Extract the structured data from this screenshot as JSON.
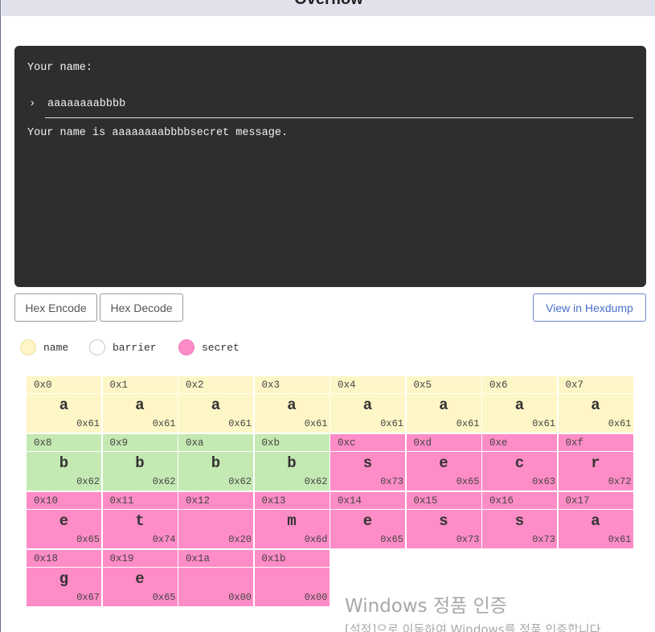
{
  "header": {
    "title": "Overflow"
  },
  "terminal": {
    "prompt": "Your name:",
    "prompt_arrow": "›",
    "input_value": "aaaaaaaabbbb",
    "output": "Your name is aaaaaaaabbbbsecret message."
  },
  "buttons": {
    "hex_encode": "Hex Encode",
    "hex_decode": "Hex Decode",
    "view_hexdump": "View in Hexdump"
  },
  "legend": [
    {
      "label": "name",
      "color": "#fef6c6"
    },
    {
      "label": "barrier",
      "color": "#ffffff"
    },
    {
      "label": "secret",
      "color": "#fe8cc6"
    }
  ],
  "colors": {
    "name": "#fef6c6",
    "barrier": "#c4e9b3",
    "secret": "#fe8cc6",
    "terminal_bg": "#2e2e2e",
    "accent": "#4a6fc9"
  },
  "memory": [
    {
      "addr": "0x0",
      "ch": "a",
      "hex": "0x61",
      "kind": "name"
    },
    {
      "addr": "0x1",
      "ch": "a",
      "hex": "0x61",
      "kind": "name"
    },
    {
      "addr": "0x2",
      "ch": "a",
      "hex": "0x61",
      "kind": "name"
    },
    {
      "addr": "0x3",
      "ch": "a",
      "hex": "0x61",
      "kind": "name"
    },
    {
      "addr": "0x4",
      "ch": "a",
      "hex": "0x61",
      "kind": "name"
    },
    {
      "addr": "0x5",
      "ch": "a",
      "hex": "0x61",
      "kind": "name"
    },
    {
      "addr": "0x6",
      "ch": "a",
      "hex": "0x61",
      "kind": "name"
    },
    {
      "addr": "0x7",
      "ch": "a",
      "hex": "0x61",
      "kind": "name"
    },
    {
      "addr": "0x8",
      "ch": "b",
      "hex": "0x62",
      "kind": "barrier"
    },
    {
      "addr": "0x9",
      "ch": "b",
      "hex": "0x62",
      "kind": "barrier"
    },
    {
      "addr": "0xa",
      "ch": "b",
      "hex": "0x62",
      "kind": "barrier"
    },
    {
      "addr": "0xb",
      "ch": "b",
      "hex": "0x62",
      "kind": "barrier"
    },
    {
      "addr": "0xc",
      "ch": "s",
      "hex": "0x73",
      "kind": "secret"
    },
    {
      "addr": "0xd",
      "ch": "e",
      "hex": "0x65",
      "kind": "secret"
    },
    {
      "addr": "0xe",
      "ch": "c",
      "hex": "0x63",
      "kind": "secret"
    },
    {
      "addr": "0xf",
      "ch": "r",
      "hex": "0x72",
      "kind": "secret"
    },
    {
      "addr": "0x10",
      "ch": "e",
      "hex": "0x65",
      "kind": "secret"
    },
    {
      "addr": "0x11",
      "ch": "t",
      "hex": "0x74",
      "kind": "secret"
    },
    {
      "addr": "0x12",
      "ch": "",
      "hex": "0x20",
      "kind": "secret"
    },
    {
      "addr": "0x13",
      "ch": "m",
      "hex": "0x6d",
      "kind": "secret"
    },
    {
      "addr": "0x14",
      "ch": "e",
      "hex": "0x65",
      "kind": "secret"
    },
    {
      "addr": "0x15",
      "ch": "s",
      "hex": "0x73",
      "kind": "secret"
    },
    {
      "addr": "0x16",
      "ch": "s",
      "hex": "0x73",
      "kind": "secret"
    },
    {
      "addr": "0x17",
      "ch": "a",
      "hex": "0x61",
      "kind": "secret"
    },
    {
      "addr": "0x18",
      "ch": "g",
      "hex": "0x67",
      "kind": "secret"
    },
    {
      "addr": "0x19",
      "ch": "e",
      "hex": "0x65",
      "kind": "secret"
    },
    {
      "addr": "0x1a",
      "ch": "",
      "hex": "0x00",
      "kind": "secret"
    },
    {
      "addr": "0x1b",
      "ch": "",
      "hex": "0x00",
      "kind": "secret"
    }
  ],
  "watermark": {
    "line1": "Windows 정품 인증",
    "line2": "[설정]으로 이동하여 Windows를 정품 인증합니다."
  }
}
